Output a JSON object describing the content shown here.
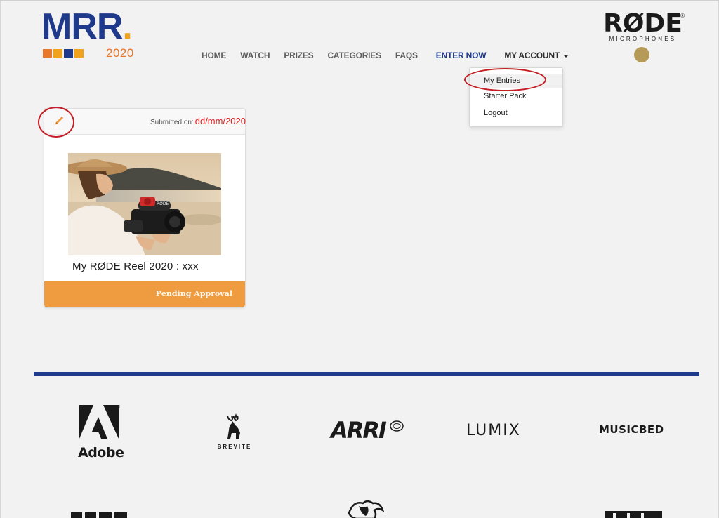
{
  "brand": {
    "mrr_text": "MRR",
    "mrr_dot": ".",
    "year": "2020",
    "bar_colors": [
      "#e8782a",
      "#f0a21c",
      "#1f3a8a",
      "#f0a21c"
    ],
    "rode_word": "RØDE",
    "rode_sub": "MICROPHONES",
    "rode_reg": "®"
  },
  "nav": {
    "items": [
      {
        "label": "HOME"
      },
      {
        "label": "WATCH"
      },
      {
        "label": "PRIZES"
      },
      {
        "label": "CATEGORIES"
      },
      {
        "label": "FAQS"
      }
    ],
    "enter_now": "ENTER NOW",
    "account": "MY ACCOUNT"
  },
  "account_menu": {
    "items": [
      {
        "label": "My Entries",
        "active": true
      },
      {
        "label": "Starter Pack"
      },
      {
        "label": "Logout"
      }
    ]
  },
  "entry": {
    "submitted_label": "Submitted on:",
    "submitted_date": "dd/mm/2020",
    "title": "My RØDE Reel 2020 : xxx",
    "status": "Pending Approval",
    "edit_icon": "pencil-icon"
  },
  "colors": {
    "accent_blue": "#1f3a8a",
    "accent_orange": "#ef9b3f",
    "highlight_red": "#c41e24",
    "rode_gold": "#b59a58"
  },
  "sponsors": {
    "row1": [
      "Adobe",
      "BREVITĒ",
      "ARRI",
      "LUMIX",
      "MUSICBED"
    ]
  }
}
